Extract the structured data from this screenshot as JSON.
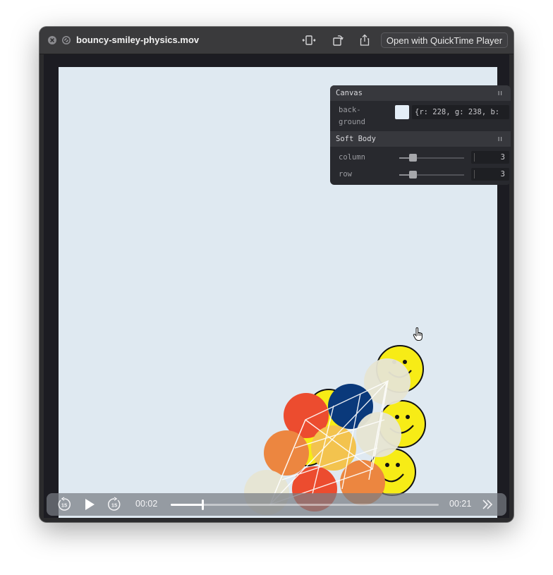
{
  "window": {
    "title": "bouncy-smiley-physics.mov",
    "open_button_label": "Open with QuickTime Player"
  },
  "panel": {
    "canvas_section": {
      "title": "Canvas",
      "background_label_line1": "back-",
      "background_label_line2": "ground",
      "background_value": "{r: 228, g: 238, b:",
      "background_swatch_color": "#e4eef7"
    },
    "softbody_section": {
      "title": "Soft Body",
      "column_label": "column",
      "column_value": "3",
      "row_label": "row",
      "row_value": "3"
    }
  },
  "player": {
    "current_time": "00:02",
    "total_time": "00:21",
    "progress_fraction": 0.12,
    "skip_back_seconds": "15",
    "skip_forward_seconds": "15"
  },
  "colors": {
    "canvas_bg": "#dfe9f1",
    "smiley_yellow": "#f7ec16",
    "red": "#ec4c2f",
    "orange": "#ec8640",
    "navy": "#0a397b",
    "cream": "#e6e4d2",
    "light_orange": "#f3c34e"
  },
  "icons": {
    "close": "close-icon",
    "block": "circle-slash-icon",
    "resize": "resize-icon",
    "rotate": "rotate-icon",
    "share": "share-icon",
    "play": "play-icon",
    "skip_back": "skip-back-15-icon",
    "skip_forward": "skip-forward-15-icon",
    "fast_forward": "double-chevron-right-icon",
    "live_text": "live-text-icon",
    "cursor": "hand-pointer-icon"
  }
}
